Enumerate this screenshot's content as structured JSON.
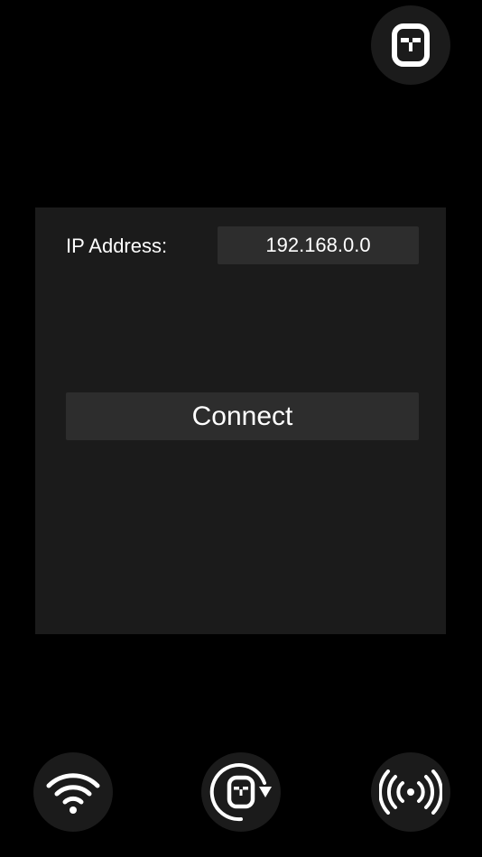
{
  "form": {
    "ip_label": "IP Address:",
    "ip_value": "192.168.0.0"
  },
  "actions": {
    "connect_label": "Connect"
  },
  "icons": {
    "top_right": "robot-face-icon",
    "bottom_left": "wifi-icon",
    "bottom_center": "robot-rotate-icon",
    "bottom_right": "radio-signal-icon"
  },
  "colors": {
    "background": "#000000",
    "panel": "#1b1b1b",
    "control": "#2d2d2d",
    "text": "#ffffff"
  }
}
